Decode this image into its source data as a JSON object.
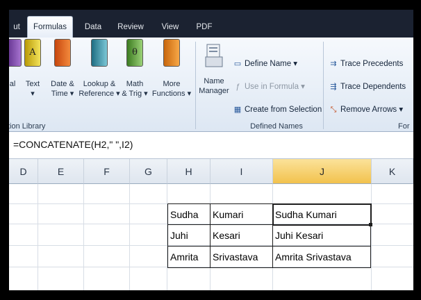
{
  "tabs": [
    {
      "label": "ut"
    },
    {
      "label": "Formulas"
    },
    {
      "label": "Data"
    },
    {
      "label": "Review"
    },
    {
      "label": "View"
    },
    {
      "label": "PDF"
    }
  ],
  "function_library": {
    "group_label": "tion Library",
    "buttons": [
      {
        "label": "al",
        "sub": ""
      },
      {
        "label": "Text",
        "sub": "▾",
        "glyph": "A"
      },
      {
        "label": "Date &",
        "sub": "Time ▾"
      },
      {
        "label": "Lookup &",
        "sub": "Reference ▾"
      },
      {
        "label": "Math",
        "sub": "& Trig ▾",
        "glyph": "θ"
      },
      {
        "label": "More",
        "sub": "Functions ▾"
      }
    ]
  },
  "defined_names": {
    "group_label": "Defined Names",
    "name_manager": {
      "line1": "Name",
      "line2": "Manager"
    },
    "define_name": "Define Name ▾",
    "use_in_formula": "Use in Formula ▾",
    "create_from_selection": "Create from Selection"
  },
  "formula_auditing": {
    "group_label": "For",
    "trace_precedents": "Trace Precedents",
    "trace_dependents": "Trace Dependents",
    "remove_arrows": "Remove Arrows ▾"
  },
  "formula_bar": {
    "text": "=CONCATENATE(H2,\" \",I2)"
  },
  "columns": [
    "D",
    "E",
    "F",
    "G",
    "H",
    "I",
    "J",
    "K"
  ],
  "selected_column": "J",
  "rows": [
    {
      "h": "Sudha",
      "i": "Kumari",
      "j": "Sudha Kumari"
    },
    {
      "h": "Juhi",
      "i": "Kesari",
      "j": "Juhi Kesari"
    },
    {
      "h": "Amrita",
      "i": "Srivastava",
      "j": "Amrita Srivastava"
    }
  ]
}
